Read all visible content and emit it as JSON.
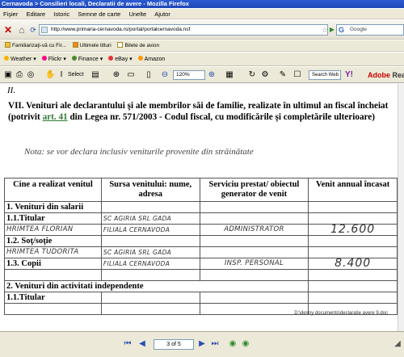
{
  "window": {
    "title": "Cernavoda > Consilieri locali, Declaratii de avere - Mozilla Firefox"
  },
  "menu": [
    "Fişier",
    "Editare",
    "Istoric",
    "Semne de carte",
    "Unelte",
    "Ajutor"
  ],
  "nav": {
    "url": "http://www.primaria-cernavoda.ro/portal/portalcernavoda.nsf",
    "search_placeholder": "Google"
  },
  "bookmarks": [
    "Familiarizaţi-vă cu Fir...",
    "Ultimele titluri",
    "Bilete de avion"
  ],
  "yahoo_toolbar": [
    "Weather",
    "Flickr",
    "Finance",
    "eBay",
    "Amazon"
  ],
  "pdf_toolbar": {
    "select_label": "Select",
    "zoom": "120%",
    "search_placeholder": "Search Web",
    "adobe_label": "Adobe",
    "adobe_suffix": "Rea"
  },
  "document": {
    "fragment": "II.",
    "heading_part1": "VII. Venituri ale declarantului şi ale membrilor săi de familie, realizate în ultimul an fiscal încheiat (potrivit ",
    "heading_link": "art. 41",
    "heading_part2": " din Legea nr. 571/2003 - Codul fiscal, cu modificările şi completările ulterioare)",
    "nota": "Nota: se vor declara inclusiv veniturile provenite din străinătate",
    "table": {
      "headers": [
        "Cine a realizat venitul",
        "Sursa venitului: nume, adresa",
        "Serviciu prestat/ obiectul generator de venit",
        "Venit annual încasat"
      ],
      "rows": [
        {
          "c1": "1. Venituri din salarii",
          "c2": "",
          "c3": "",
          "c4": ""
        },
        {
          "c1": "1.1.Titular",
          "c2": "SC AGIRIA SRL GADA",
          "c3": "",
          "c4": ""
        },
        {
          "c1": "HRIMTEA FLORIAN",
          "c2": "FILIALA CERNAVODA",
          "c3": "ADMINISTRATOR",
          "c4": "12.600"
        },
        {
          "c1": "1.2. Soţ/soţie",
          "c2": "",
          "c3": "",
          "c4": ""
        },
        {
          "c1": "HRIMTEA TUDORITA",
          "c2": "SC AGIRIA SRL GADA",
          "c3": "",
          "c4": ""
        },
        {
          "c1": "1.3. Copii",
          "c2": "FILIALA CERNAVODA",
          "c3": "INSP. PERSONAL",
          "c4": "8.400"
        },
        {
          "c1": "",
          "c2": "",
          "c3": "",
          "c4": ""
        },
        {
          "c1": "2. Venituri din activitati independente",
          "c2": "",
          "c3": "",
          "c4": ""
        },
        {
          "c1": "1.1.Titular",
          "c2": "",
          "c3": "",
          "c4": ""
        },
        {
          "c1": "",
          "c2": "",
          "c3": "",
          "c4": ""
        }
      ]
    },
    "footer_path": "D:\\de\\my documents\\declaratie avere 9.doc"
  },
  "pager": {
    "page": "3 of 5"
  }
}
